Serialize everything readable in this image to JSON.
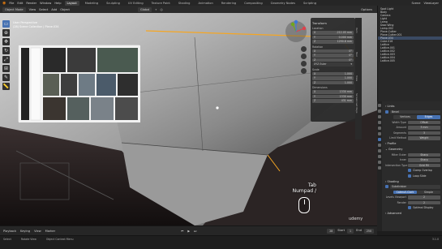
{
  "app": {
    "menu": [
      "File",
      "Edit",
      "Render",
      "Window",
      "Help"
    ],
    "workspaces": [
      "Layout",
      "Modeling",
      "Sculpting",
      "UV Editing",
      "Texture Paint",
      "Shading",
      "Animation",
      "Rendering",
      "Compositing",
      "Geometry Nodes",
      "Scripting"
    ],
    "active_workspace": "Layout",
    "scene_label": "Scene",
    "view_layer_label": "ViewLayer"
  },
  "viewport_header": {
    "mode": "Object Mode",
    "menus": [
      "View",
      "Select",
      "Add",
      "Object"
    ],
    "orientation": "Global",
    "options_label": "Options"
  },
  "viewport": {
    "view_name": "User Perspective",
    "collection_info": "(28) Scene Collection | Plane.034",
    "key_hint_line1": "Tab",
    "key_hint_line2": "Numpad /",
    "watermark": "udemy"
  },
  "npanel": {
    "section_transform": "Transform",
    "location_label": "Location",
    "location": [
      "-212.05 mm",
      "0.000 mm",
      "1290.8 mm"
    ],
    "rotation_label": "Rotation",
    "rotation": [
      "0°",
      "0°",
      "0°"
    ],
    "rotation_mode": "XYZ Euler",
    "scale_label": "Scale",
    "scale": [
      "1.000",
      "1.000",
      "1.000"
    ],
    "dimensions_label": "Dimensions",
    "dimensions": [
      "1330 mm",
      "1330 mm",
      "431 mm"
    ],
    "tabs": [
      "Item",
      "Tool",
      "View",
      "Screencast Keys"
    ]
  },
  "outliner": {
    "items": [
      "Spot Light",
      "Body",
      "Camera",
      "Light",
      "Lamp",
      "Door.Wing",
      "Lamp.002",
      "Plane.Cutter",
      "Plane.Cutter.001",
      "Plane.034",
      "Cube.016",
      "Lattice",
      "Lattice.001",
      "Lattice.002",
      "Lattice.003",
      "Lattice.004",
      "Lattice.005"
    ],
    "selected_index": 9
  },
  "properties": {
    "section_links": "Links",
    "modifier_name": "Bevel",
    "tab_vertices": "Vertices",
    "tab_edges": "Edges",
    "width_type_label": "Width Type",
    "width_type": "Offset",
    "amount_label": "Amount",
    "amount": "3 mm",
    "segments_label": "Segments",
    "segments": "3",
    "limit_method_label": "Limit Method",
    "limit_method": "Weight",
    "profile_label": "Profile",
    "geometry_label": "Geometry",
    "miter_outer_label": "Miter Outer",
    "miter_outer": "Sharp",
    "inner_label": "Inner",
    "inner": "Sharp",
    "intersection_label": "Intersection Type",
    "intersection": "Grid Fill",
    "clamp_label": "Clamp Overlap",
    "loop_slide_label": "Loop Slide",
    "shading_label": "Shading",
    "modifier2_name": "Subdivision",
    "catmull": "Catmull-Clark",
    "simple": "Simple",
    "levels_viewport_label": "Levels Viewport",
    "levels_viewport": "2",
    "render_label": "Render",
    "render": "2",
    "optimal_label": "Optimal Display",
    "advanced_label": "Advanced"
  },
  "timeline": {
    "menus": [
      "Playback",
      "Keying",
      "View",
      "Marker"
    ],
    "current_frame": "28",
    "start_label": "Start",
    "start": "1",
    "end_label": "End",
    "end": "250"
  },
  "statusbar": {
    "items": [
      "Select",
      "Rotate View",
      "Object Context Menu"
    ],
    "version": "3.1.0"
  },
  "colors": {
    "accent": "#4772b3",
    "selection_outline": "#f5a623"
  }
}
